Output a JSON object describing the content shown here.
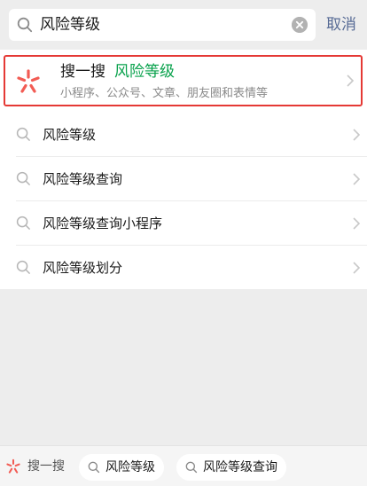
{
  "search": {
    "query": "风险等级",
    "cancel_label": "取消"
  },
  "featured": {
    "title": "搜一搜",
    "keyword": "风险等级",
    "subtitle": "小程序、公众号、文章、朋友圈和表情等"
  },
  "suggestions": [
    {
      "label": "风险等级"
    },
    {
      "label": "风险等级查询"
    },
    {
      "label": "风险等级查询小程序"
    },
    {
      "label": "风险等级划分"
    }
  ],
  "bottom": {
    "label": "搜一搜",
    "chips": [
      {
        "label": "风险等级"
      },
      {
        "label": "风险等级查询"
      }
    ]
  },
  "colors": {
    "accent_green": "#07a14b",
    "highlight_border": "#e53935",
    "cancel_blue": "#576b95",
    "logo_red": "#f25c54"
  },
  "icons": {
    "search": "magnifier-icon",
    "clear": "clear-circle-icon",
    "logo": "sou-yi-sou-logo-icon",
    "arrow": "chevron-right-icon"
  }
}
